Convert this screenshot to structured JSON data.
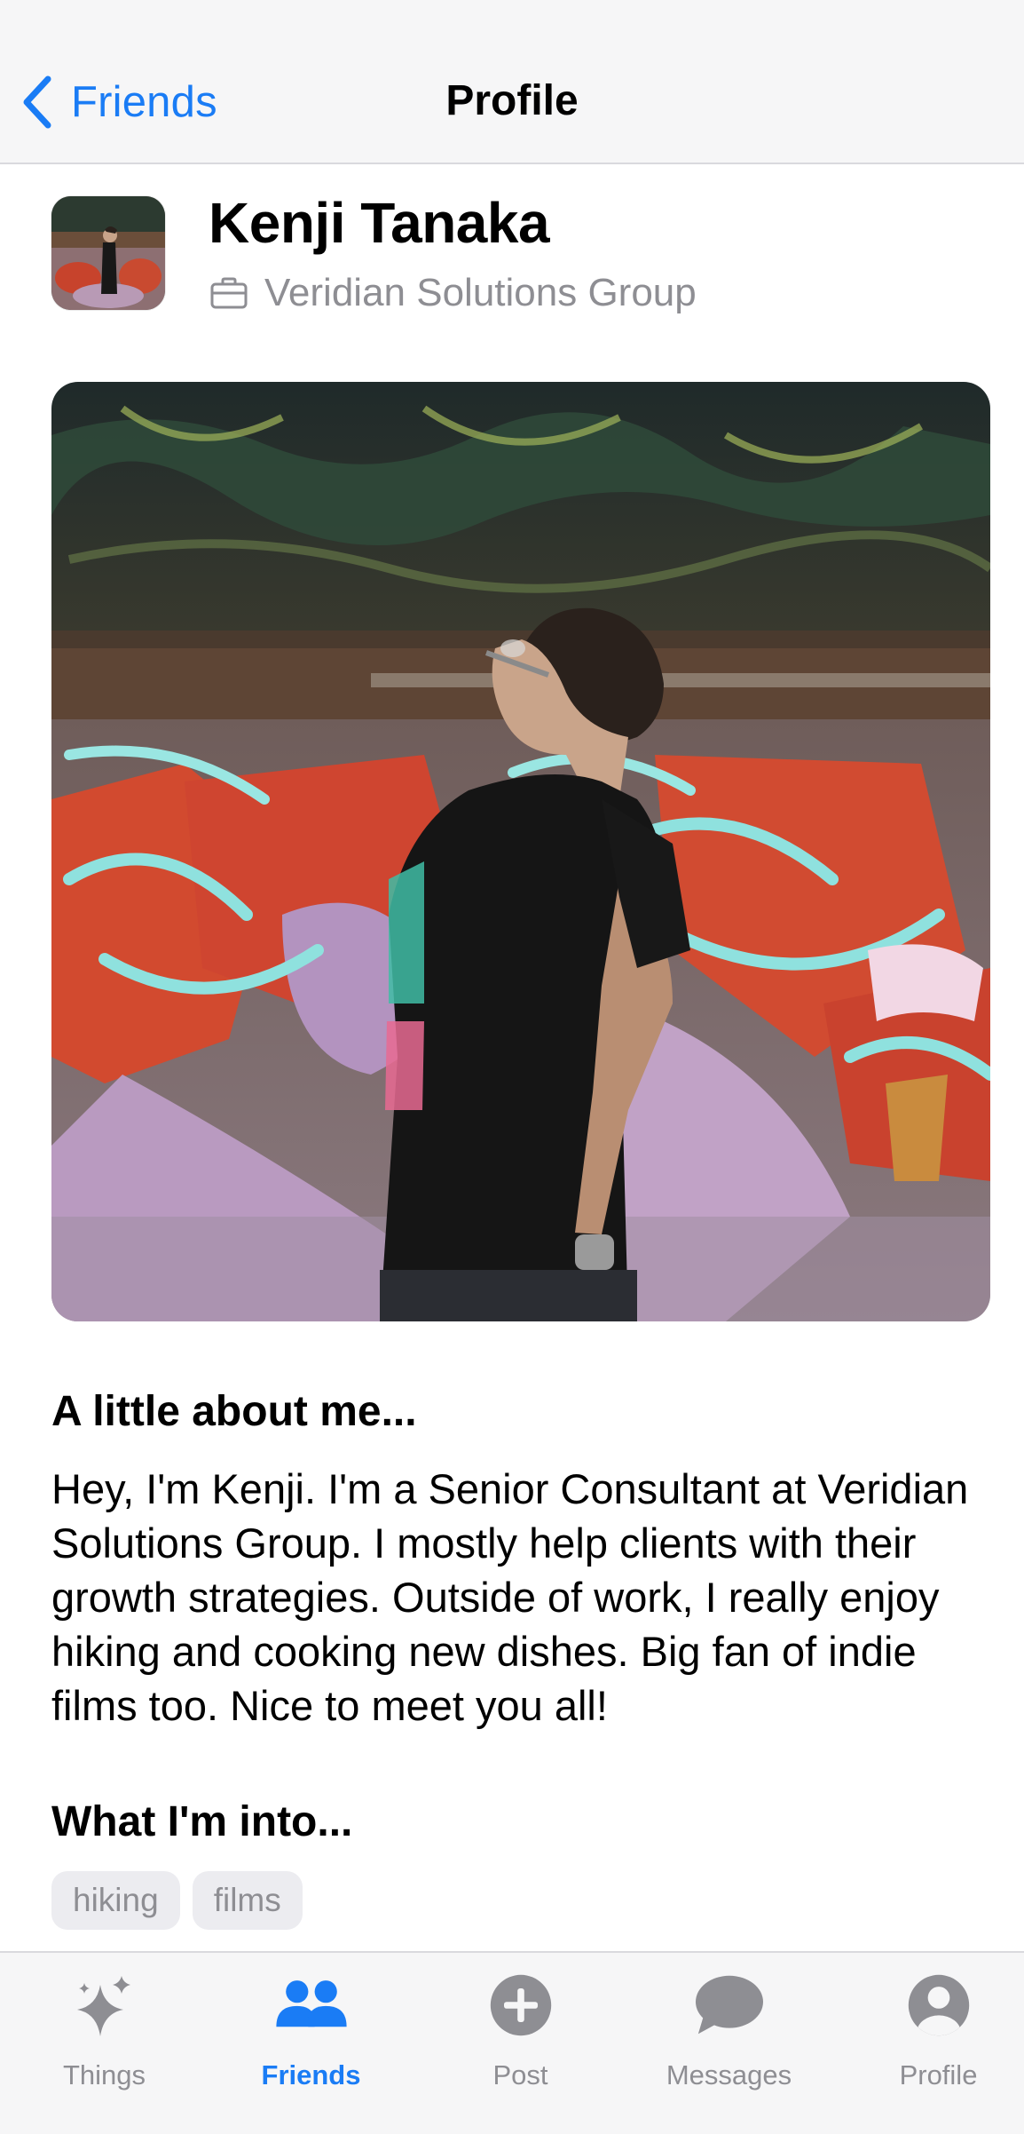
{
  "nav": {
    "back_label": "Friends",
    "title": "Profile"
  },
  "profile": {
    "name": "Kenji Tanaka",
    "company": "Veridian Solutions Group"
  },
  "about": {
    "heading": "A little about me...",
    "body": "Hey, I'm Kenji. I'm a Senior Consultant at Veridian Solutions Group. I mostly help clients with their growth strategies. Outside of work, I really enjoy hiking and cooking new dishes. Big fan of indie films too. Nice to meet you all!"
  },
  "interests": {
    "heading": "What I'm into...",
    "tags": [
      "hiking",
      "films"
    ]
  },
  "tabbar": {
    "items": [
      {
        "label": "Things",
        "icon": "sparkles-icon",
        "active": false
      },
      {
        "label": "Friends",
        "icon": "people-icon",
        "active": true
      },
      {
        "label": "Post",
        "icon": "plus-circle-icon",
        "active": false
      },
      {
        "label": "Messages",
        "icon": "chat-bubble-icon",
        "active": false
      },
      {
        "label": "Profile",
        "icon": "person-circle-icon",
        "active": false
      }
    ]
  },
  "colors": {
    "accent": "#1a7cf5",
    "secondary_text": "#8e8e93",
    "tag_background": "#ececf0",
    "bar_background": "#f6f6f7"
  }
}
